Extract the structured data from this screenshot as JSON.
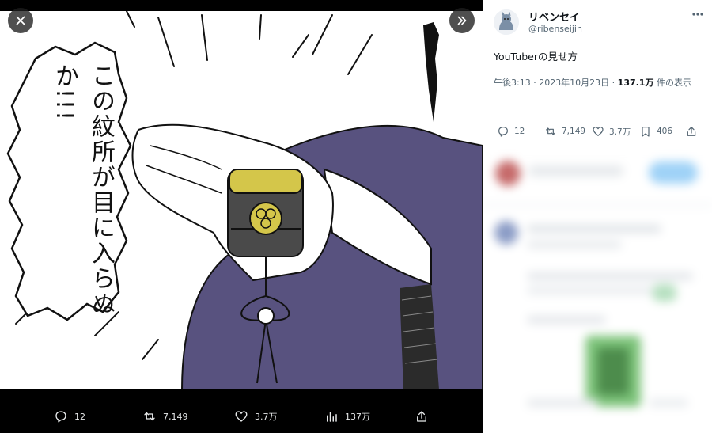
{
  "viewer": {
    "close_icon": "close-icon",
    "expand_icon": "chevrons-right-icon",
    "speech_text": "この紋所が目に入らぬか!!!",
    "stats": {
      "replies": "12",
      "reposts": "7,149",
      "likes": "3.7万",
      "views": "137万"
    }
  },
  "tweet": {
    "display_name": "リベンセイ",
    "handle": "@ribenseijin",
    "text": "YouTuberの見せ方",
    "time_date": "午後3:13 · 2023年10月23日 · ",
    "views_count": "137.1万",
    "views_suffix": " 件の表示",
    "stats": {
      "replies": "12",
      "reposts": "7,149",
      "likes": "3.7万",
      "bookmarks": "406"
    }
  },
  "colors": {
    "robe": "#58527f",
    "tweet_accent": "#1d9bf0"
  }
}
